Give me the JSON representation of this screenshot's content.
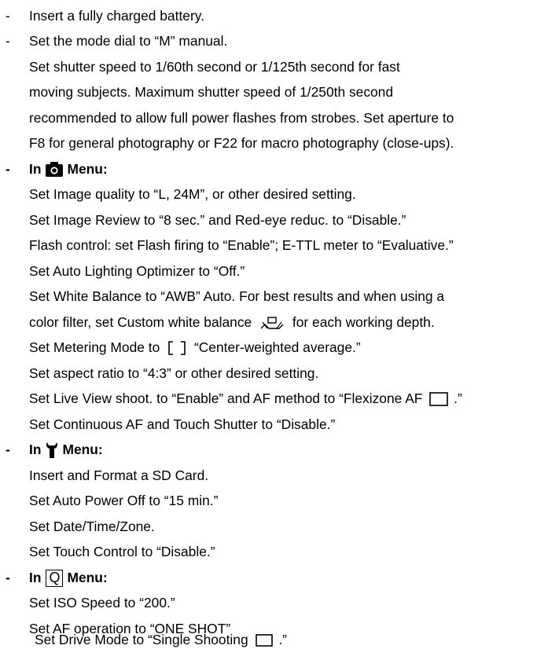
{
  "doc": {
    "bullet": "-",
    "l1": "Insert a fully charged battery.",
    "l2": "Set the mode dial to “M” manual.",
    "l3": "Set shutter speed to 1/60th second or 1/125th second for fast",
    "l4": "moving subjects. Maximum shutter speed of 1/250th second",
    "l5": "recommended to allow full power flashes from strobes. Set aperture to",
    "l6": "F8 for general photography or F22 for macro photography (close-ups).",
    "h1_pre": "In",
    "h1_post": "Menu:",
    "l7": "Set Image quality to “L, 24M”, or other desired setting.",
    "l8": "Set Image Review  to “8 sec.” and Red-eye reduc. to “Disable.”",
    "l9": "Flash control: set Flash firing to “Enable”; E-TTL meter to “Evaluative.”",
    "l10": "Set Auto Lighting Optimizer to “Off.”",
    "l11": "Set White Balance to “AWB” Auto. For best results and when using a",
    "l12a": "color filter, set Custom white balance",
    "l12b": "for each working depth.",
    "l13a": "Set Metering Mode to",
    "l13b": "“Center-weighted average.”",
    "l14": "Set aspect ratio to “4:3” or other desired setting.",
    "l15a": "Set Live View shoot. to “Enable” and AF method to “Flexizone AF",
    "l15b": ".”",
    "l16": "Set Continuous AF and Touch Shutter to “Disable.”",
    "h2_pre": "In",
    "h2_post": "Menu:",
    "l17": "Insert and Format a SD Card.",
    "l18": "Set Auto Power Off to “15 min.”",
    "l19": "Set Date/Time/Zone.",
    "l20": "Set Touch Control to “Disable.”",
    "h3_pre": "In",
    "h3_icon_letter": "Q",
    "h3_post": "Menu:",
    "l21": "Set ISO Speed to “200.”",
    "l22": "Set AF operation to “ONE SHOT”",
    "l23a": "Set Drive Mode to “Single Shooting",
    "l23b": ".”"
  },
  "icons": {
    "h1": "camera-icon",
    "h2": "wrench-icon",
    "h3": "q-menu-icon",
    "custom_wb": "custom-white-balance-icon",
    "metering": "center-weighted-metering-icon",
    "flexizone": "flexizone-af-icon",
    "single_shooting": "single-shooting-icon"
  }
}
